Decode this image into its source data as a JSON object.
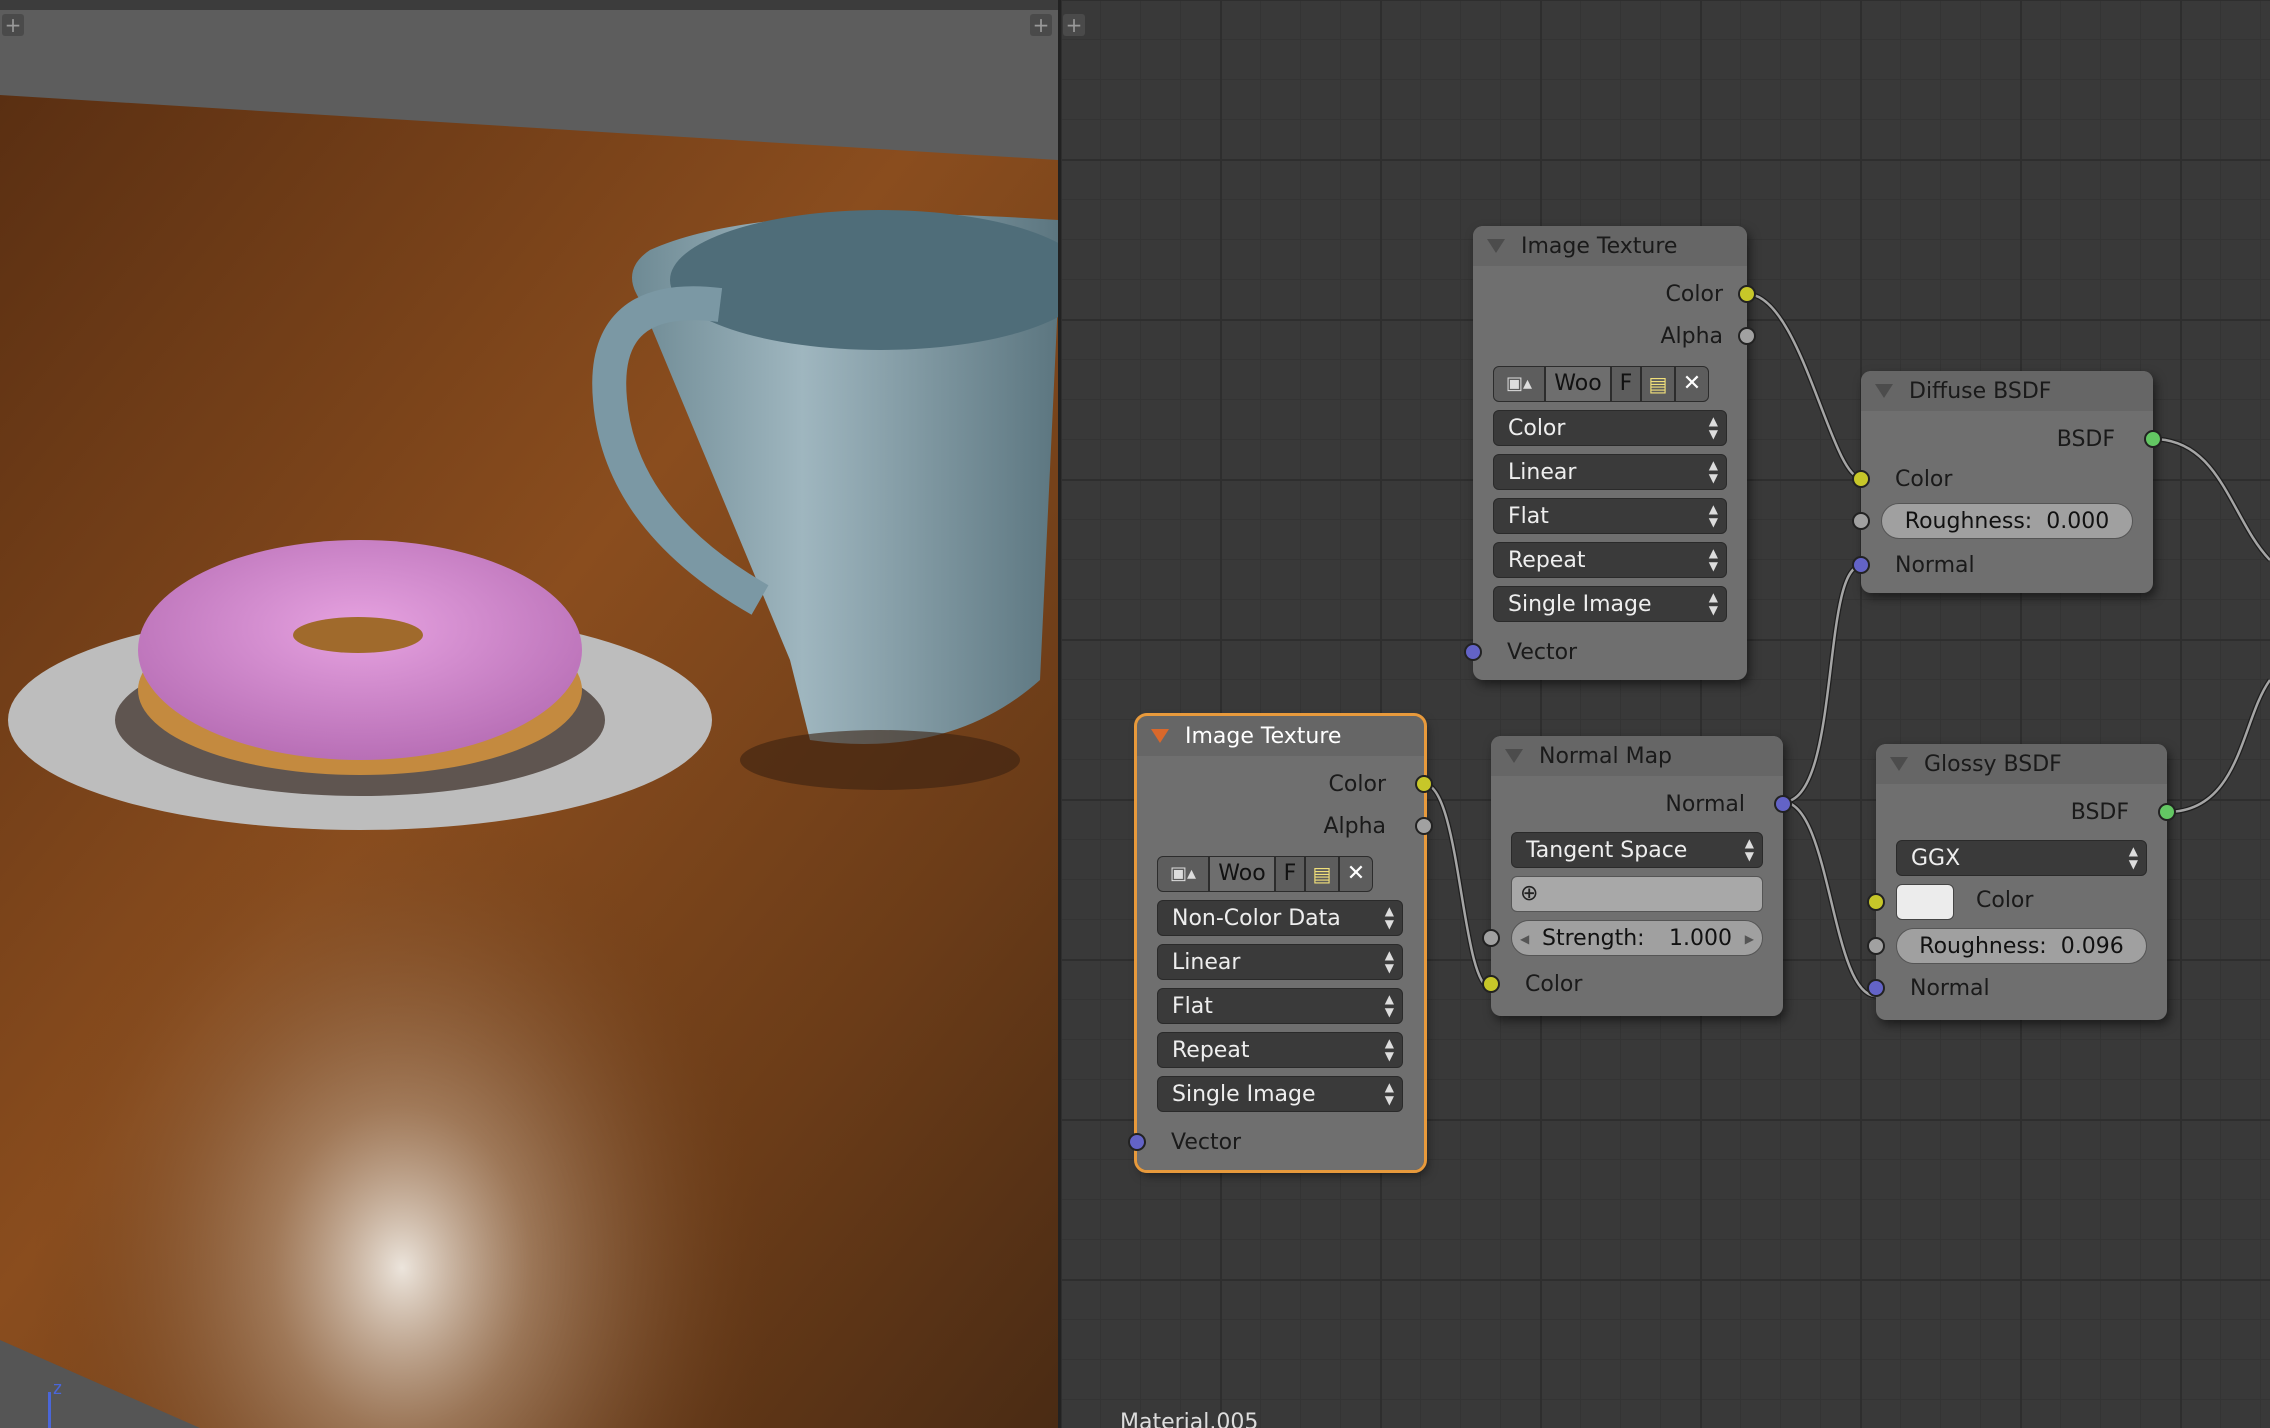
{
  "viewport": {
    "add_icon": "plus-icon",
    "axis_label": "z"
  },
  "node_editor": {
    "add_icon": "plus-icon",
    "material_label": "Material.005",
    "nodes": {
      "image_texture_1": {
        "title": "Image Texture",
        "outputs": [
          "Color",
          "Alpha"
        ],
        "image_name": "Woo",
        "fake_user": "F",
        "color_space": "Color",
        "interpolation": "Linear",
        "projection": "Flat",
        "extension": "Repeat",
        "source": "Single Image",
        "input": "Vector"
      },
      "image_texture_2": {
        "title": "Image Texture",
        "outputs": [
          "Color",
          "Alpha"
        ],
        "image_name": "Woo",
        "fake_user": "F",
        "color_space": "Non-Color Data",
        "interpolation": "Linear",
        "projection": "Flat",
        "extension": "Repeat",
        "source": "Single Image",
        "input": "Vector"
      },
      "normal_map": {
        "title": "Normal Map",
        "output": "Normal",
        "space": "Tangent Space",
        "strength_label": "Strength:",
        "strength_value": "1.000",
        "input_color": "Color"
      },
      "diffuse": {
        "title": "Diffuse BSDF",
        "output": "BSDF",
        "color": "Color",
        "roughness_label": "Roughness:",
        "roughness_value": "0.000",
        "normal": "Normal"
      },
      "glossy": {
        "title": "Glossy BSDF",
        "output": "BSDF",
        "distribution": "GGX",
        "color": "Color",
        "roughness_label": "Roughness:",
        "roughness_value": "0.096",
        "normal": "Normal",
        "swatch_color": "#ececec"
      }
    }
  },
  "colors": {
    "socket_color": "#c7c729",
    "socket_float": "#a1a1a1",
    "socket_vector": "#6363c7",
    "socket_shader": "#63c763",
    "active_outline": "#e89a3c"
  }
}
